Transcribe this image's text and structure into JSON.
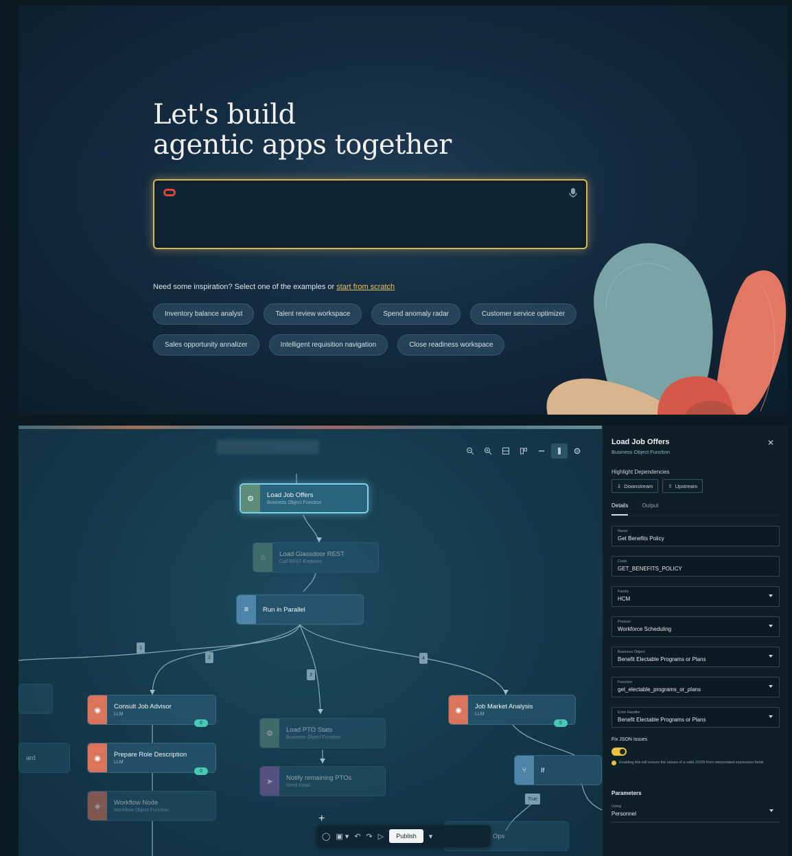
{
  "hero": {
    "title_line1": "Let's build",
    "title_line2": "agentic apps together",
    "prompt_placeholder": "",
    "inspiration_text": "Need some inspiration? Select one of the examples or ",
    "start_link": "start from scratch",
    "chips_row1": [
      "Inventory balance analyst",
      "Talent review workspace",
      "Spend anomaly radar",
      "Customer service optimizer"
    ],
    "chips_row2": [
      "Sales opportunity annalizer",
      "Intelligent requisition navigation",
      "Close readiness workspace"
    ],
    "accent_color": "#d9b94a"
  },
  "canvas": {
    "breadcrumb": "",
    "nodes": {
      "load_job_offers": {
        "title": "Load Job Offers",
        "sub": "Business Object Function"
      },
      "load_glassdoor": {
        "title": "Load Glassdoor REST",
        "sub": "Call REST Endpoint"
      },
      "run_parallel": {
        "title": "Run in Parallel",
        "sub": ""
      },
      "consult_job_advisor": {
        "title": "Consult Job Advisor",
        "sub": "LLM",
        "badge": "0"
      },
      "prepare_role": {
        "title": "Prepare Role Description",
        "sub": "LLM",
        "badge": "0"
      },
      "workflow_node": {
        "title": "Workflow Node",
        "sub": "Workflow Object Function"
      },
      "load_pto": {
        "title": "Load PTO Stats",
        "sub": "Business Object Function"
      },
      "notify_pto": {
        "title": "Notify remaining PTOs",
        "sub": "Send Email"
      },
      "job_market": {
        "title": "Job Market Analysis",
        "sub": "LLM",
        "badge": "5"
      },
      "if_node": {
        "title": "If",
        "sub": ""
      },
      "cut_right": {
        "title": "Ops",
        "sub": ""
      },
      "cut_left": {
        "title": "ard",
        "sub": ""
      }
    },
    "edge_tags": [
      "1",
      "2",
      "3",
      "4"
    ],
    "true_tag": "True",
    "plus": "+",
    "bottom_bar": {
      "publish": "Publish"
    }
  },
  "panel": {
    "title": "Load Job Offers",
    "subtitle": "Business Object Function",
    "highlight_heading": "Highlight Dependencies",
    "downstream": "Downstream",
    "upstream": "Upstream",
    "tabs": [
      "Details",
      "Output"
    ],
    "fields": [
      {
        "label": "Name",
        "value": "Get Benefits Policy",
        "dropdown": false
      },
      {
        "label": "Code",
        "value": "GET_BENEFITS_POLICY",
        "dropdown": false
      },
      {
        "label": "Family",
        "value": "HCM",
        "dropdown": true
      },
      {
        "label": "Product",
        "value": "Workforce Scheduling",
        "dropdown": true
      },
      {
        "label": "Business Object",
        "value": "Benefit Electable Programs or Plans",
        "dropdown": true
      },
      {
        "label": "Function",
        "value": "get_electable_programs_or_plans",
        "dropdown": true
      },
      {
        "label": "Error Handler",
        "value": "Benefit Electable Programs or Plans",
        "dropdown": true
      }
    ],
    "toggle_label": "Fix JSON Issues",
    "toggle_hint": "Enabling this will ensure the values of a valid JSON from interpolated expression fields",
    "parameters_heading": "Parameters",
    "param_label": "Using",
    "param_value": "Personnel"
  }
}
